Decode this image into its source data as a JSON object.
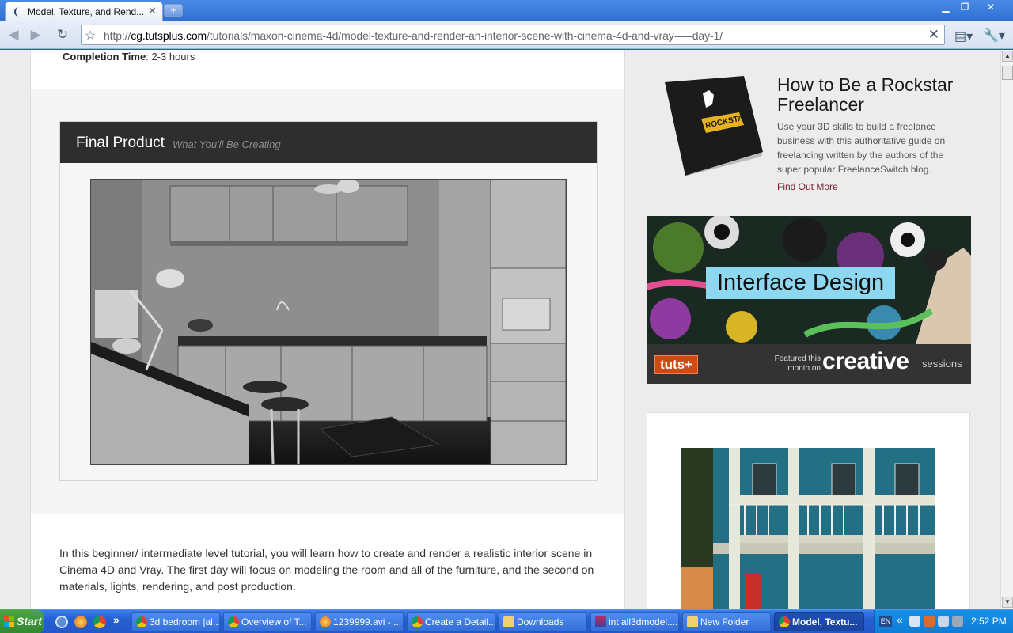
{
  "browser": {
    "tab_title": "Model, Texture, and Rend...",
    "new_tab": "+",
    "url_prefix": "http://",
    "url_host": "cg.tutsplus.com",
    "url_path": "/tutorials/maxon-cinema-4d/model-texture-and-render-an-interior-scene-with-cinema-4d-and-vray-—-day-1/",
    "window_controls": [
      "minimize-icon",
      "restore-icon",
      "close-icon"
    ]
  },
  "article": {
    "completion_label": "Completion Time",
    "completion_value": ": 2-3 hours",
    "final_product_title": "Final Product",
    "final_product_sub": "What You'll Be Creating",
    "intro_text": "In this beginner/ intermediate level tutorial, you will learn how to create and render a realistic interior scene in Cinema 4D and Vray. The first day will focus on modeling the room and all of the furniture, and the second on materials, lights, rendering, and post production."
  },
  "sidebar": {
    "promo_title": "How to Be a Rockstar Freelancer",
    "promo_desc": "Use your 3D skills to build a freelance business with this authoritative guide on freelancing written by the authors of the super popular FreelanceSwitch blog.",
    "promo_link": "Find Out More",
    "book_cover_text": "ROCKSTAR",
    "ad_label": "Interface Design",
    "ad_tuts": "tuts+",
    "ad_featured": "Featured this month on",
    "ad_creative": "creative",
    "ad_sessions": "sessions"
  },
  "taskbar": {
    "start": "Start",
    "quicklaunch_more": "»",
    "tasks": [
      {
        "label": "3d bedroom |al...",
        "icon": "chrome-icon"
      },
      {
        "label": "Overview of T...",
        "icon": "chrome-icon"
      },
      {
        "label": "1239999.avi - ...",
        "icon": "vlc-icon"
      },
      {
        "label": "Create a Detail...",
        "icon": "chrome-icon"
      },
      {
        "label": "Downloads",
        "icon": "folder-icon"
      },
      {
        "label": "int all3dmodel....",
        "icon": "winrar-icon"
      },
      {
        "label": "New Folder",
        "icon": "folder-icon"
      },
      {
        "label": "Model, Textu...",
        "icon": "chrome-icon"
      }
    ],
    "lang": "EN",
    "tray_chevron": "«",
    "clock": "2:52 PM"
  },
  "colors": {
    "xp_blue": "#245fd0",
    "start_green": "#3a9638",
    "header_dark": "#2e2e2e",
    "link": "#7a2030",
    "ad_accent": "#8dd7f0"
  }
}
